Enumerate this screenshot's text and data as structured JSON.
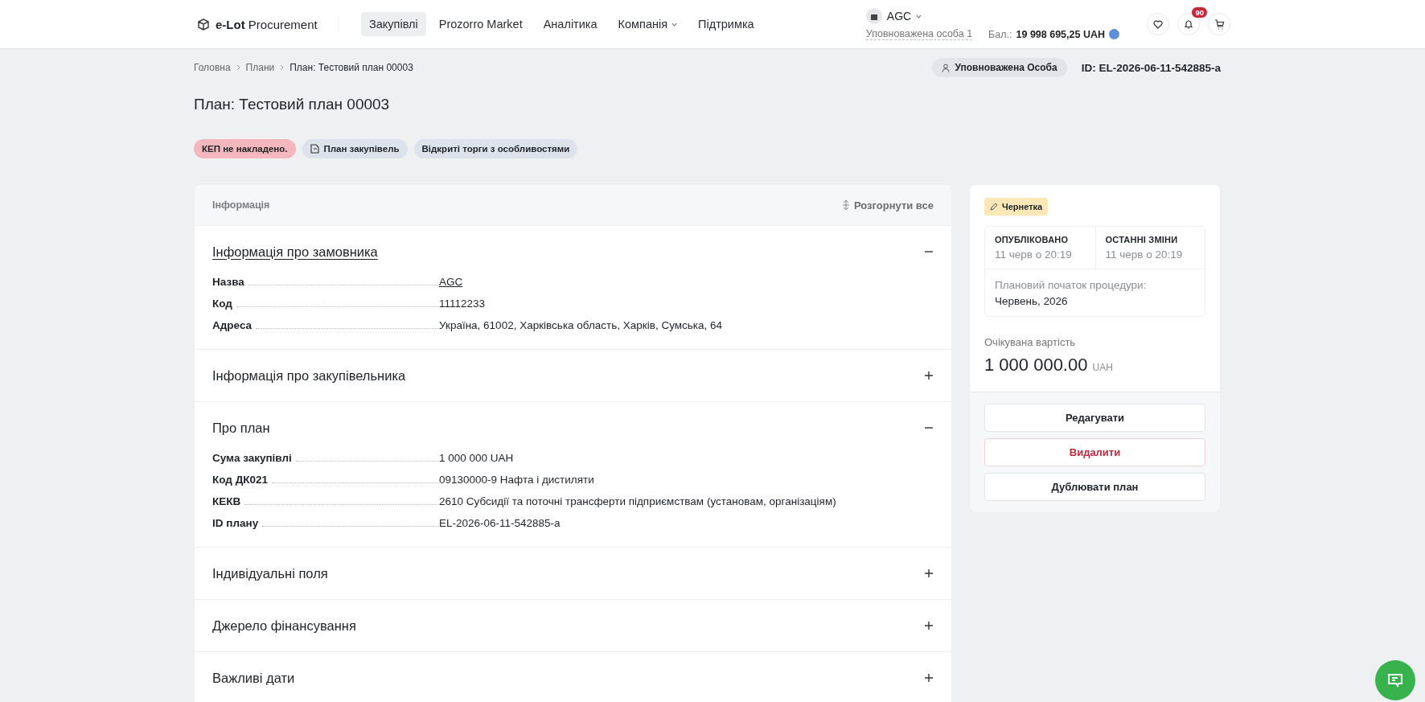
{
  "header": {
    "logo": "e-Lot Procurement",
    "nav": [
      {
        "label": "Закупівлі",
        "selected": true,
        "dropdown": false
      },
      {
        "label": "Prozorro Market",
        "selected": false,
        "dropdown": false
      },
      {
        "label": "Аналітика",
        "selected": false,
        "dropdown": false
      },
      {
        "label": "Компанія",
        "selected": false,
        "dropdown": true
      },
      {
        "label": "Підтримка",
        "selected": false,
        "dropdown": false
      }
    ],
    "org": "AGC",
    "user": "Уповноважена особа 1",
    "balance_label": "Бал.:",
    "balance": "19 998 695,25 UAH",
    "notifications": "90"
  },
  "breadcrumbs": [
    "Головна",
    "Плани",
    "План: Тестовий план 00003"
  ],
  "role": "Уповноважена Особа",
  "plan_id": "ID: EL-2026-06-11-542885-a",
  "title": "План: Тестовий план 00003",
  "tags": [
    {
      "label": "КЕП не накладено.",
      "kind": "warning"
    },
    {
      "label": "План закупівель",
      "kind": "icon"
    },
    {
      "label": "Відкриті торги з особливостями",
      "kind": "plain"
    }
  ],
  "info": {
    "title": "Інформація",
    "expand_all": "Розгорнути все",
    "sections": [
      {
        "title": "Інформація про замовника",
        "expanded": true,
        "hovered": true,
        "fields": [
          {
            "label": "Назва",
            "value": "AGC",
            "kind": "link"
          },
          {
            "label": "Код",
            "value": "11112233",
            "kind": "text"
          },
          {
            "label": "Адреса",
            "value": "Україна, 61002, Харківська область, Харків, Сумська, 64",
            "kind": "text"
          }
        ]
      },
      {
        "title": "Інформація про закупівельника",
        "expanded": false,
        "hovered": false
      },
      {
        "title": "Про план",
        "expanded": true,
        "hovered": false,
        "fields": [
          {
            "label": "Сума закупівлі",
            "value": "1 000 000 UAH",
            "kind": "text"
          },
          {
            "label": "Код ДК021",
            "value": "09130000-9 Нафта і дистиляти",
            "kind": "text"
          },
          {
            "label": "КЕКВ",
            "value": "2610 Субсидії та поточні трансферти підприємствам (установам, організаціям)",
            "kind": "text"
          },
          {
            "label": "ID плану",
            "value": "EL-2026-06-11-542885-a",
            "kind": "text"
          }
        ]
      },
      {
        "title": "Індивідуальні поля",
        "expanded": false,
        "hovered": false
      },
      {
        "title": "Джерело фінансування",
        "expanded": false,
        "hovered": false
      },
      {
        "title": "Важливі дати",
        "expanded": false,
        "hovered": false
      }
    ]
  },
  "sidebar": {
    "status": "Чернетка",
    "published_label": "ОПУБЛІКОВАНО",
    "published": "11 черв о 20:19",
    "changed_label": "ОСТАННІ ЗМІНИ",
    "changed": "11 черв о 20:19",
    "start_label": "Плановий початок процедури:",
    "start": "Червень, 2026",
    "cost_label": "Очікувана вартість",
    "cost": "1 000 000.00",
    "currency": "UAH",
    "buttons": [
      {
        "label": "Редагувати",
        "kind": "default"
      },
      {
        "label": "Видалити",
        "kind": "danger"
      },
      {
        "label": "Дублювати план",
        "kind": "default"
      }
    ]
  }
}
